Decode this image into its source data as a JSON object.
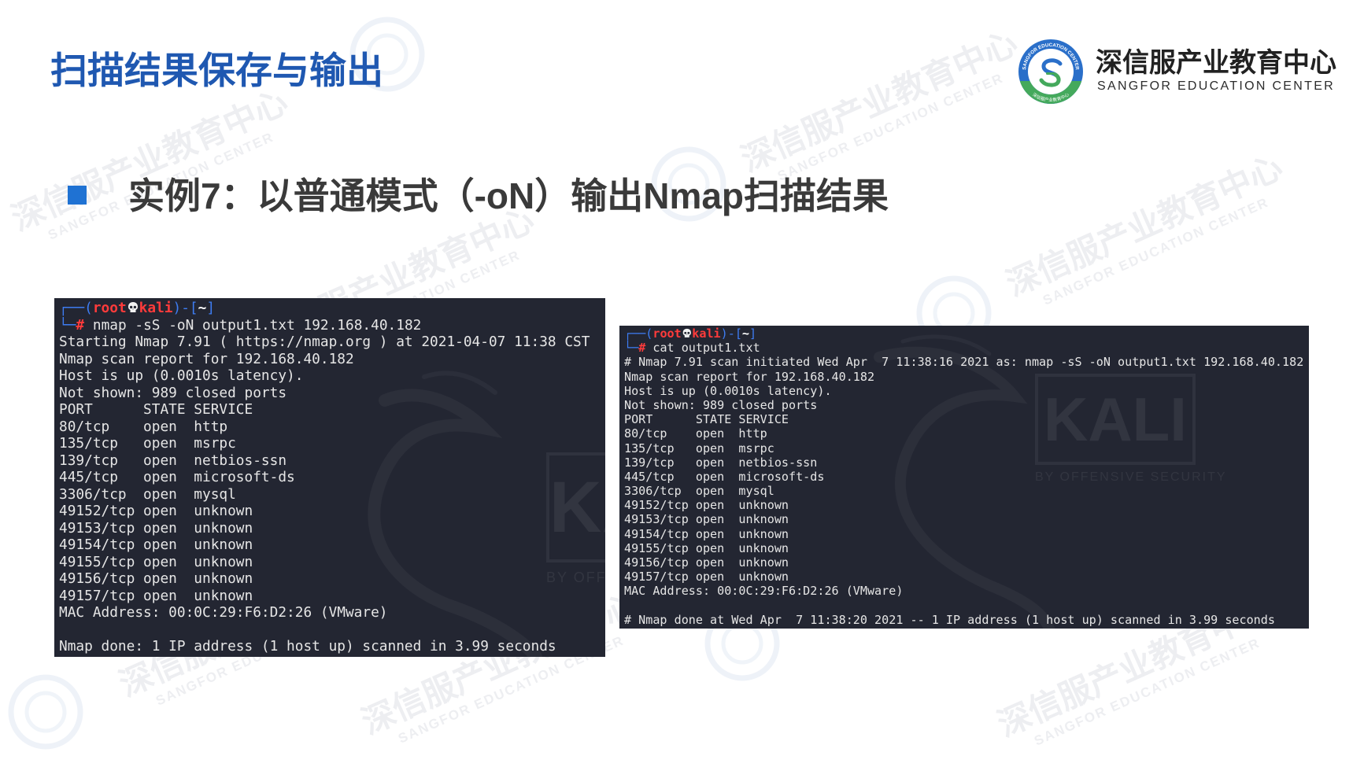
{
  "slide": {
    "title": "扫描结果保存与输出",
    "subtitle": "实例7：以普通模式（-oN）输出Nmap扫描结果",
    "bullet_icon": "square-bullet-icon",
    "colors": {
      "title": "#1f58b1",
      "bullet": "#1f72d3",
      "subtitle": "#3a3a3a",
      "terminal_bg": "#232632",
      "prompt_blue": "#3e7df3",
      "prompt_red": "#ff3b3b"
    }
  },
  "brand": {
    "logo_icon": "sangfor-education-badge-icon",
    "name_cn": "深信服产业教育中心",
    "name_en": "SANGFOR EDUCATION CENTER",
    "badge_top_text": "SANGFOR EDUCATION CENTER",
    "badge_bottom_text": "深信服产业教育中心",
    "colors": {
      "ring_blue": "#2a6fc9",
      "ring_green": "#44a95c"
    }
  },
  "watermark": {
    "cn": "深信服产业教育中心",
    "en": "SANGFOR EDUCATION CENTER"
  },
  "kali_watermark": {
    "word": "KALI",
    "tagline": "BY OFFENSIVE SECURITY",
    "icon": "kali-dragon-icon"
  },
  "prompt": {
    "top_open": "┌──(",
    "user": "root",
    "skull_icon": "skull-icon",
    "host": "kali",
    "mid": ")-[",
    "dir": "~",
    "close": "]",
    "bottom_prefix": "└─",
    "symbol": "#"
  },
  "terminals": [
    {
      "command": "nmap -sS -oN output1.txt 192.168.40.182",
      "output": [
        "Starting Nmap 7.91 ( https://nmap.org ) at 2021-04-07 11:38 CST",
        "Nmap scan report for 192.168.40.182",
        "Host is up (0.0010s latency).",
        "Not shown: 989 closed ports",
        "PORT      STATE SERVICE",
        "80/tcp    open  http",
        "135/tcp   open  msrpc",
        "139/tcp   open  netbios-ssn",
        "445/tcp   open  microsoft-ds",
        "3306/tcp  open  mysql",
        "49152/tcp open  unknown",
        "49153/tcp open  unknown",
        "49154/tcp open  unknown",
        "49155/tcp open  unknown",
        "49156/tcp open  unknown",
        "49157/tcp open  unknown",
        "MAC Address: 00:0C:29:F6:D2:26 (VMware)",
        "",
        "Nmap done: 1 IP address (1 host up) scanned in 3.99 seconds"
      ]
    },
    {
      "command": "cat output1.txt",
      "output": [
        "# Nmap 7.91 scan initiated Wed Apr  7 11:38:16 2021 as: nmap -sS -oN output1.txt 192.168.40.182",
        "Nmap scan report for 192.168.40.182",
        "Host is up (0.0010s latency).",
        "Not shown: 989 closed ports",
        "PORT      STATE SERVICE",
        "80/tcp    open  http",
        "135/tcp   open  msrpc",
        "139/tcp   open  netbios-ssn",
        "445/tcp   open  microsoft-ds",
        "3306/tcp  open  mysql",
        "49152/tcp open  unknown",
        "49153/tcp open  unknown",
        "49154/tcp open  unknown",
        "49155/tcp open  unknown",
        "49156/tcp open  unknown",
        "49157/tcp open  unknown",
        "MAC Address: 00:0C:29:F6:D2:26 (VMware)",
        "",
        "# Nmap done at Wed Apr  7 11:38:20 2021 -- 1 IP address (1 host up) scanned in 3.99 seconds"
      ]
    }
  ]
}
